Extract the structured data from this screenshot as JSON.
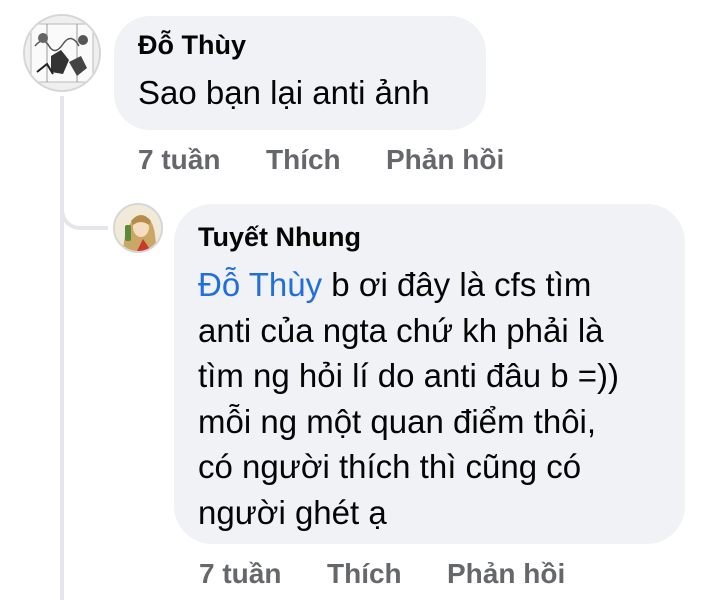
{
  "comment": {
    "author": "Đỗ Thùy",
    "text": "Sao bạn lại anti ảnh",
    "time": "7 tuần",
    "like_label": "Thích",
    "reply_label": "Phản hồi"
  },
  "reply": {
    "author": "Tuyết Nhung",
    "mention": "Đỗ Thùy",
    "lines": [
      " b ơi đây là cfs tìm",
      "anti của ngta chứ kh phải là",
      "tìm ng hỏi lí do anti đâu b =))",
      "mỗi ng một quan điểm thôi,",
      "có người thích thì cũng có",
      "người ghét ạ"
    ],
    "time": "7 tuần",
    "like_label": "Thích",
    "reply_label": "Phản hồi"
  },
  "colors": {
    "bubble": "#f0f2f5",
    "mention": "#216fdb",
    "meta": "#65676b",
    "thread_line": "#e4e6eb"
  }
}
